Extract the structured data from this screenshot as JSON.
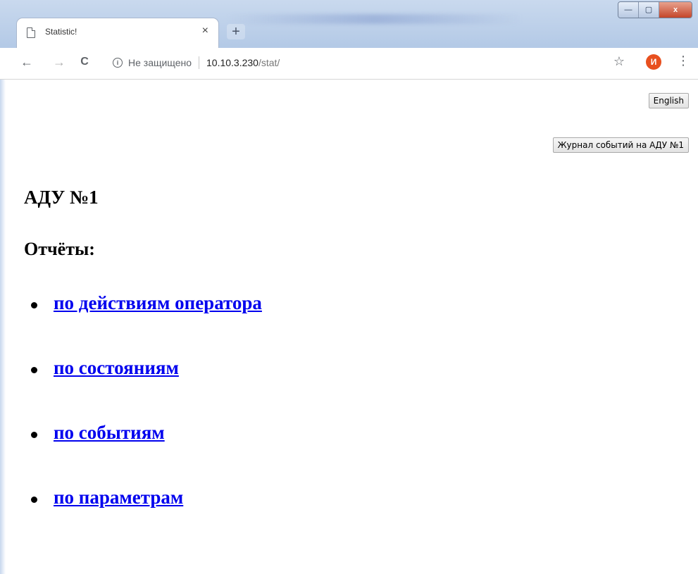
{
  "browser": {
    "tab_title": "Statistic!",
    "tab_close": "×",
    "new_tab": "+",
    "controls": {
      "minimize": "—",
      "maximize": "▢",
      "close": "x"
    },
    "nav": {
      "back": "←",
      "forward": "→",
      "reload": "C"
    },
    "address": {
      "security_icon": "ⓘ",
      "security_text": "Не защищено",
      "host": "10.10.3.230",
      "path": "/stat/"
    },
    "bookmark": "☆",
    "profile_initial": "И",
    "menu": "⋮"
  },
  "page": {
    "language_button": "English",
    "journal_button": "Журнал событий на АДУ №1",
    "device_title": "АДУ №1",
    "reports_heading": "Отчёты:",
    "reports": [
      {
        "label": "по действиям оператора"
      },
      {
        "label": "по состояниям"
      },
      {
        "label": "по событиям"
      },
      {
        "label": "по параметрам"
      }
    ]
  },
  "colors": {
    "link": "#0000ee",
    "avatar": "#e8501f",
    "window_frame": "#b3c9e6"
  }
}
